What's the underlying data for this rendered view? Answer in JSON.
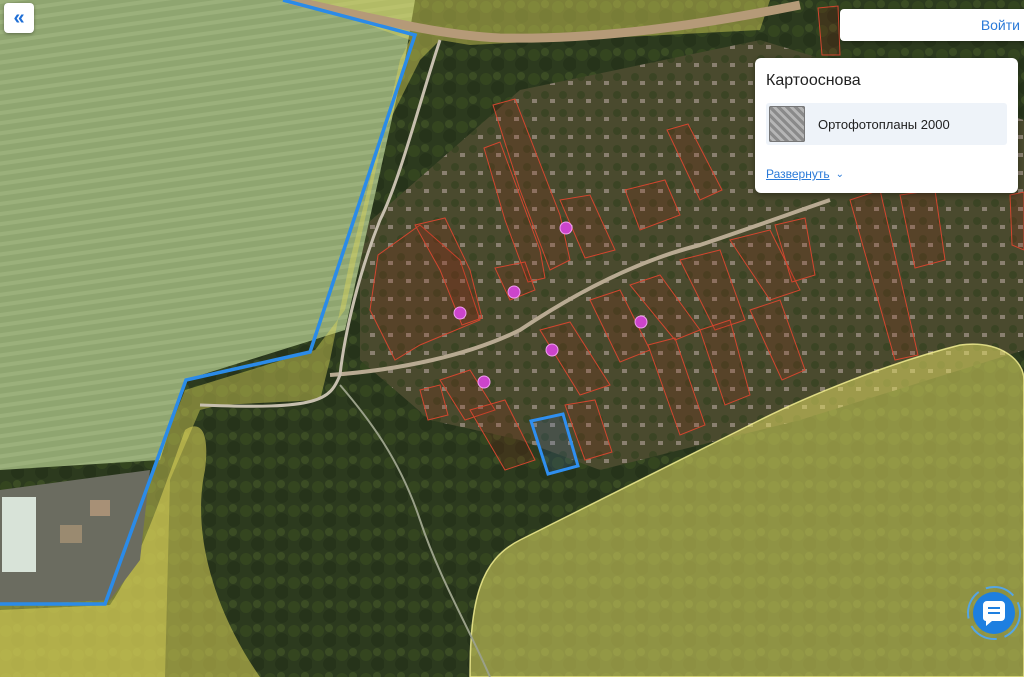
{
  "toolbar": {
    "collapse_icon": "«"
  },
  "header": {
    "login_label": "Войти"
  },
  "basemap_panel": {
    "title": "Картооснова",
    "selected_layer": "Ортофотопланы 2000",
    "expand_label": "Развернуть",
    "expand_icon": "⌄"
  },
  "icons": {
    "collapse": "double-chevron-left-icon",
    "layer_thumbnail": "orthophoto-thumbnail-icon",
    "expand": "chevron-down-icon",
    "chat": "chat-icon"
  },
  "colors": {
    "accent": "#2a7ad8",
    "selected_parcel": "#2f8ff0",
    "district_border": "#2b8be8",
    "cadastral_parcel": "#c0392b",
    "zone_fill": "#e7e06b",
    "point_marker": "#cc44cc"
  }
}
